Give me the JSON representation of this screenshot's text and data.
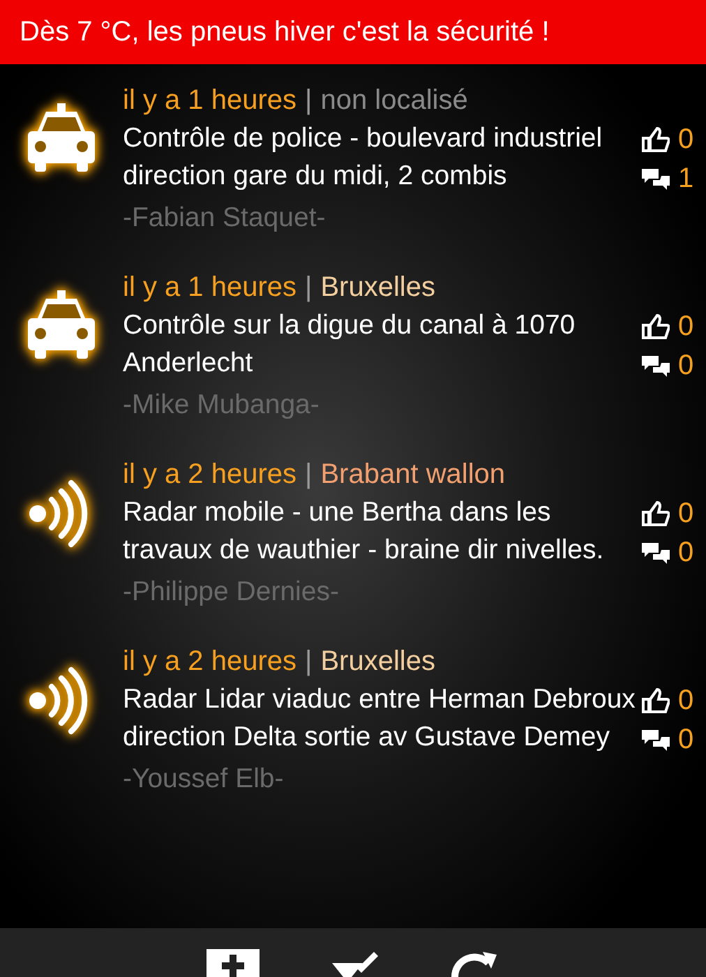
{
  "banner": "Dès 7 °C, les pneus hiver c'est la sécurité !",
  "alerts": [
    {
      "kind": "police",
      "time": "il y a 1 heures",
      "separator": "|",
      "location": "non localisé",
      "color": "#8a8a8a",
      "message": "Contrôle de police - boulevard industriel direction gare du midi, 2 combis",
      "author": "-Fabian Staquet-",
      "likes": "0",
      "comments": "1"
    },
    {
      "kind": "police",
      "time": "il y a 1 heures",
      "separator": "|",
      "location": "Bruxelles",
      "color": "#f3cfa0",
      "message": "Contrôle  sur la digue du canal à 1070 Anderlecht",
      "author": "-Mike Mubanga-",
      "likes": "0",
      "comments": "0"
    },
    {
      "kind": "radar",
      "time": "il y a 2 heures",
      "separator": "|",
      "location": "Brabant wallon",
      "color": "#f2a070",
      "message": "Radar mobile - une Bertha dans les travaux de wauthier - braine  dir nivelles.",
      "author": "-Philippe Dernies-",
      "likes": "0",
      "comments": "0"
    },
    {
      "kind": "radar",
      "time": "il y a 2 heures",
      "separator": "|",
      "location": "Bruxelles",
      "color": "#f3cfa0",
      "message": "Radar Lidar viaduc entre Herman Debroux direction Delta sortie av Gustave Demey",
      "author": "-Youssef Elb-",
      "likes": "0",
      "comments": "0"
    }
  ]
}
